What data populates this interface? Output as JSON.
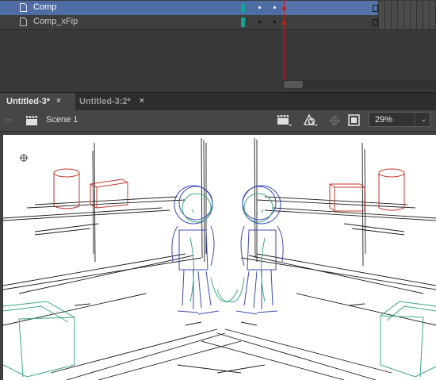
{
  "timeline": {
    "layers": [
      {
        "name": "Comp",
        "selected": true
      },
      {
        "name": "Comp_xFip",
        "selected": false
      }
    ]
  },
  "tabs": [
    {
      "label": "Untitled-3*",
      "active": true,
      "close": "×"
    },
    {
      "label": "Untitled-3:2*",
      "active": false,
      "close": "×"
    }
  ],
  "edit_bar": {
    "back": "⇦",
    "scene": "Scene 1",
    "zoom": "29%",
    "zoom_arrow": "⌄"
  },
  "icons": {
    "layer": "layer-icon",
    "scene": "clapperboard-icon",
    "edit_symbols": "clapperboard-dropdown-icon",
    "edit_scene": "symbol-dropdown-icon",
    "snap": "crosshair-icon",
    "clip": "square-frame-icon",
    "registration": "crosshair-circle-icon"
  },
  "colors": {
    "selection": "#4f6da5",
    "layer_color": "#14a496",
    "playhead": "#c41e1e",
    "sketch_red": "#c0392b",
    "sketch_blue": "#3b4bb8",
    "sketch_green": "#3aa880"
  }
}
